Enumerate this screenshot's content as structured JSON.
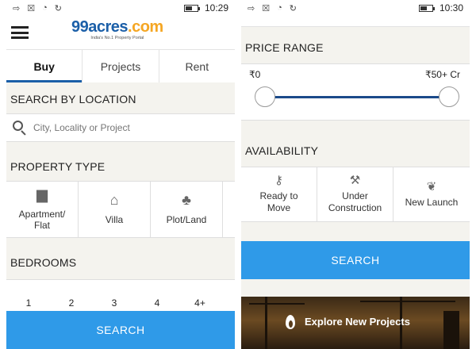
{
  "left": {
    "status": {
      "time": "10:29"
    },
    "logo": {
      "name": "99acres",
      "suffix": ".com",
      "tagline": "India's No.1 Property Portal"
    },
    "tabs": [
      {
        "label": "Buy",
        "active": true
      },
      {
        "label": "Projects",
        "active": false
      },
      {
        "label": "Rent",
        "active": false
      }
    ],
    "location": {
      "title": "SEARCH BY LOCATION",
      "placeholder": "City, Locality or Project"
    },
    "property_type": {
      "title": "PROPERTY TYPE",
      "items": [
        {
          "label_line1": "Apartment/",
          "label_line2": "Flat",
          "icon": "apartment-icon"
        },
        {
          "label_line1": "Villa",
          "label_line2": "",
          "icon": "villa-icon"
        },
        {
          "label_line1": "Plot/Land",
          "label_line2": "",
          "icon": "plot-icon"
        }
      ]
    },
    "bedrooms": {
      "title": "BEDROOMS",
      "options": [
        "1",
        "2",
        "3",
        "4",
        "4+"
      ]
    },
    "search_label": "SEARCH"
  },
  "right": {
    "status": {
      "time": "10:30"
    },
    "price": {
      "title": "PRICE RANGE",
      "min": "₹0",
      "max": "₹50+ Cr"
    },
    "availability": {
      "title": "AVAILABILITY",
      "items": [
        {
          "label_line1": "Ready to",
          "label_line2": "Move",
          "icon": "ready-to-move-icon"
        },
        {
          "label_line1": "Under",
          "label_line2": "Construction",
          "icon": "under-construction-icon"
        },
        {
          "label_line1": "New Launch",
          "label_line2": "",
          "icon": "new-launch-icon"
        }
      ]
    },
    "search_label": "SEARCH",
    "banner": {
      "text": "Explore New Projects"
    }
  },
  "colors": {
    "brand_blue": "#1b5fa8",
    "search_button": "#2f9ae8",
    "background": "#f4f3ee",
    "slider_track": "#1b4a8a"
  }
}
